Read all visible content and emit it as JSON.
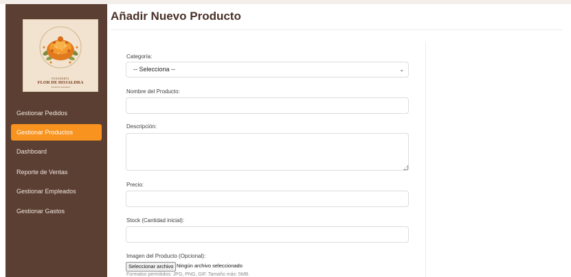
{
  "colors": {
    "sidebar_bg": "#5b3f32",
    "accent": "#f7931e",
    "title": "#4a3127"
  },
  "logo": {
    "icon": "bread-logo-icon",
    "line1": "PANADERÍA",
    "line2": "FLOR DE HOJALDRA",
    "line3": "Tradición Artesanal"
  },
  "sidebar": {
    "items": [
      {
        "label": "Gestionar Pedidos",
        "active": false
      },
      {
        "label": "Gestionar Productos",
        "active": true
      },
      {
        "label": "Dashboard",
        "active": false
      },
      {
        "label": "Reporte de Ventas",
        "active": false
      },
      {
        "label": "Gestionar Empleados",
        "active": false
      },
      {
        "label": "Gestionar Gastos",
        "active": false
      }
    ]
  },
  "page": {
    "title": "Añadir Nuevo Producto"
  },
  "form": {
    "category": {
      "label": "Categoría:",
      "selected": "-- Selecciona --"
    },
    "name": {
      "label": "Nombre del Producto:",
      "value": ""
    },
    "description": {
      "label": "Descripción:",
      "value": ""
    },
    "price": {
      "label": "Precio:",
      "value": ""
    },
    "stock": {
      "label": "Stock (Cantidad inicial):",
      "value": ""
    },
    "image": {
      "label": "Imagen del Producto (Opcional):",
      "button": "Seleccionar archivo",
      "status": "Ningún archivo seleccionado",
      "hint": "Formatos permitidos: JPG, PNG, GIF. Tamaño máx: 5MB."
    }
  }
}
